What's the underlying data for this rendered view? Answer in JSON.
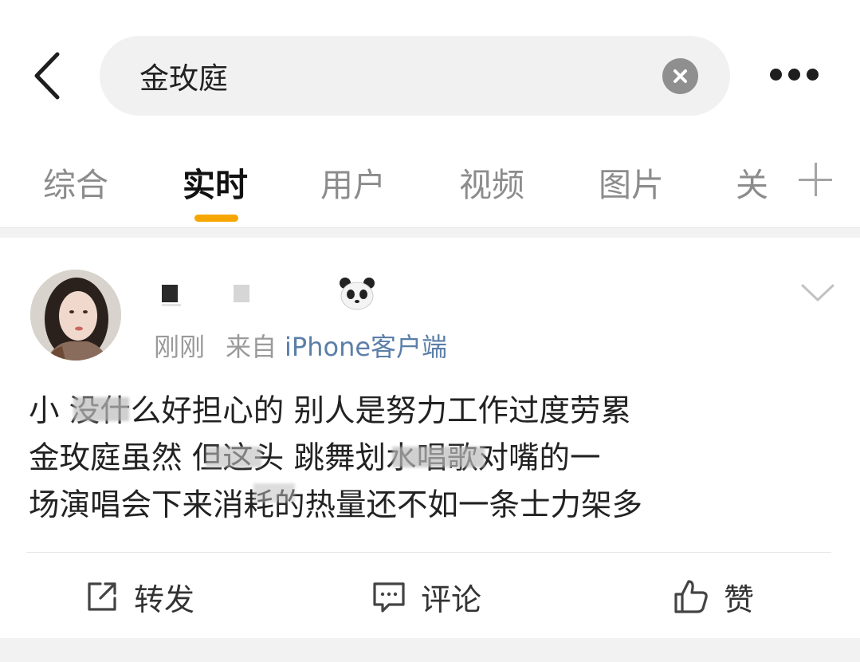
{
  "search": {
    "query": "金玫庭",
    "back_icon": "chevron-left-icon",
    "clear_icon": "clear-icon",
    "more_icon": "more-dots-icon"
  },
  "tabs": [
    {
      "label": "综合",
      "active": false
    },
    {
      "label": "实时",
      "active": true
    },
    {
      "label": "用户",
      "active": false
    },
    {
      "label": "视频",
      "active": false
    },
    {
      "label": "图片",
      "active": false
    },
    {
      "label": "关",
      "active": false
    }
  ],
  "accent_color": "#f7a600",
  "post": {
    "time": "刚刚",
    "source_prefix": "来自",
    "source": "iPhone客户端",
    "text_lines": [
      "小     没什么好担心的 别人是努力工作过度劳累",
      "金玫庭虽然    但这头           跳舞划水唱歌对嘴的一",
      "场演唱会下来消耗的热量还不如一条士力架多"
    ]
  },
  "actions": {
    "repost_label": "转发",
    "comment_label": "评论",
    "like_label": "赞"
  }
}
